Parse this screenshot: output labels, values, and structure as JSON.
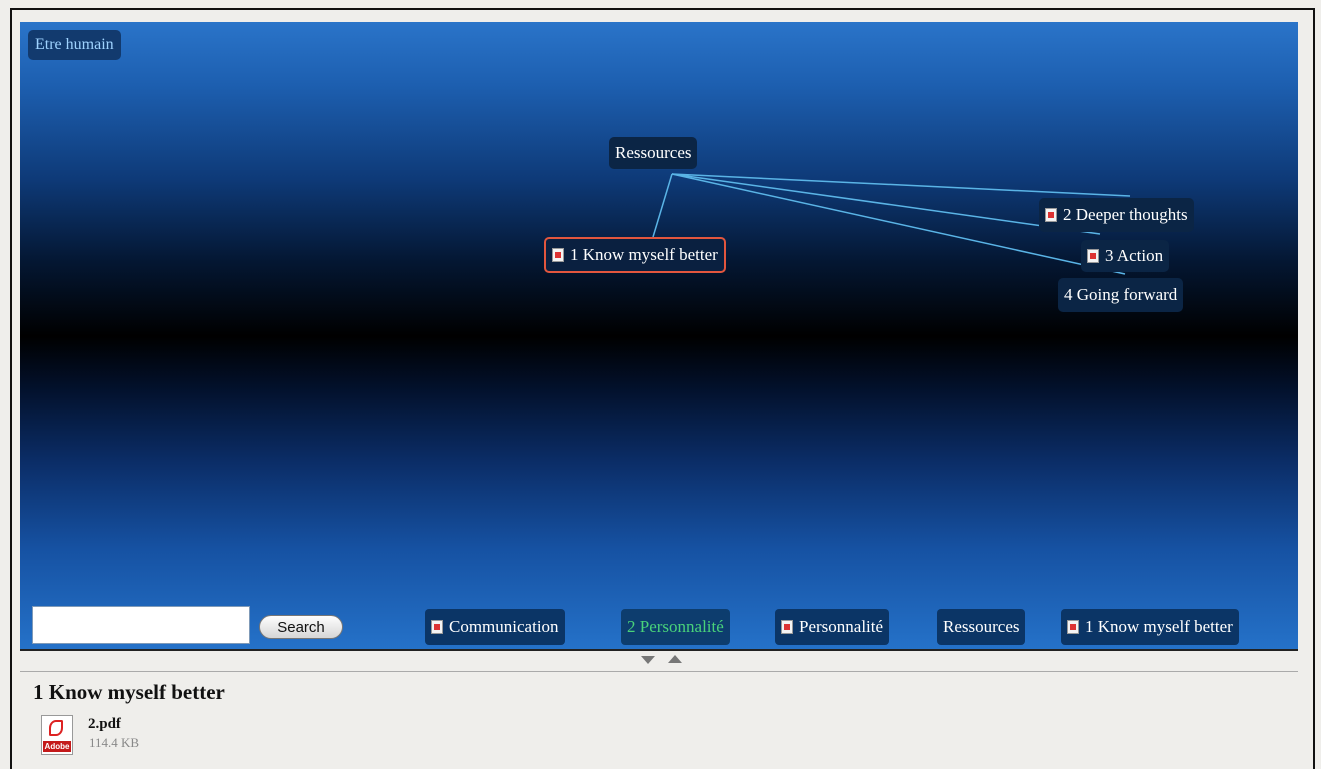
{
  "mindmap": {
    "root_label": "Etre humain",
    "center": "Ressources",
    "children": [
      {
        "label": "1 Know myself better",
        "has_pdf": true,
        "selected": true
      },
      {
        "label": "2 Deeper thoughts",
        "has_pdf": true
      },
      {
        "label": "3 Action",
        "has_pdf": true
      },
      {
        "label": "4 Going forward",
        "has_pdf": false
      }
    ],
    "edge_color": "#5ab4e6",
    "selected_border_color": "#e2563e"
  },
  "search": {
    "placeholder": "",
    "button_label": "Search"
  },
  "breadcrumb": [
    {
      "label": "Communication",
      "has_pdf": true
    },
    {
      "label": "2 Personnalité",
      "has_pdf": false,
      "active": true
    },
    {
      "label": "Personnalité",
      "has_pdf": true
    },
    {
      "label": "Ressources",
      "has_pdf": false
    },
    {
      "label": "1 Know myself better",
      "has_pdf": true
    }
  ],
  "detail": {
    "title": "1 Know myself better",
    "attachment": {
      "name": "2.pdf",
      "size": "114.4 KB",
      "icon_label": "Adobe"
    }
  }
}
